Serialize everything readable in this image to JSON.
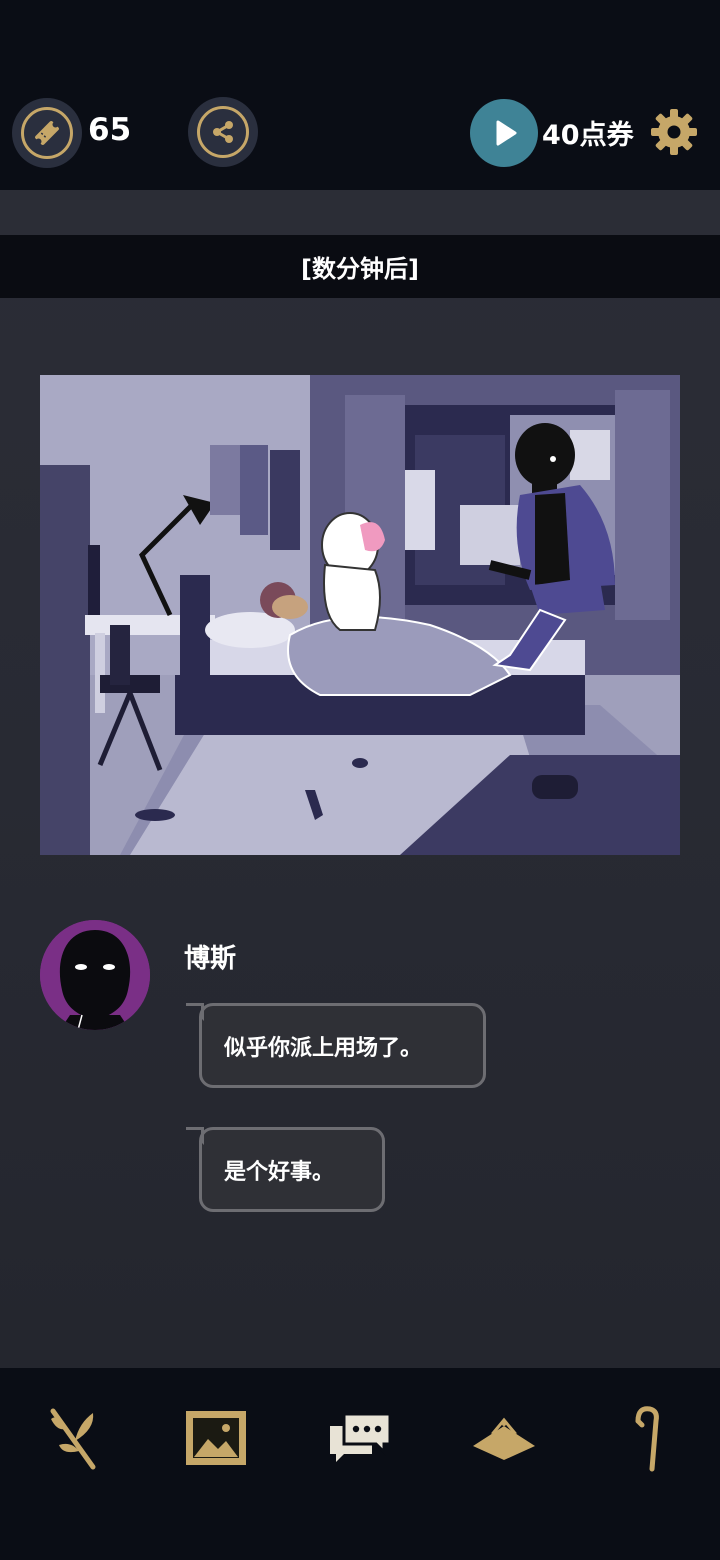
{
  "topbar": {
    "ticket_count": "65",
    "points_label": "40点券",
    "icons": [
      "ticket-icon",
      "share-icon",
      "play-icon",
      "gear-icon"
    ]
  },
  "story": {
    "time_banner": "[数分钟后]",
    "speaker_name": "博斯",
    "messages": [
      "似乎你派上用场了。",
      "是个好事。"
    ]
  },
  "bottom_nav": {
    "items": [
      "branch-icon",
      "gallery-icon",
      "chat-icon",
      "hat-icon",
      "cane-icon"
    ]
  },
  "colors": {
    "accent_gold": "#c6a768",
    "play_teal": "#3f8396",
    "avatar_purple": "#7a2f86",
    "background": "#0a0d15"
  }
}
